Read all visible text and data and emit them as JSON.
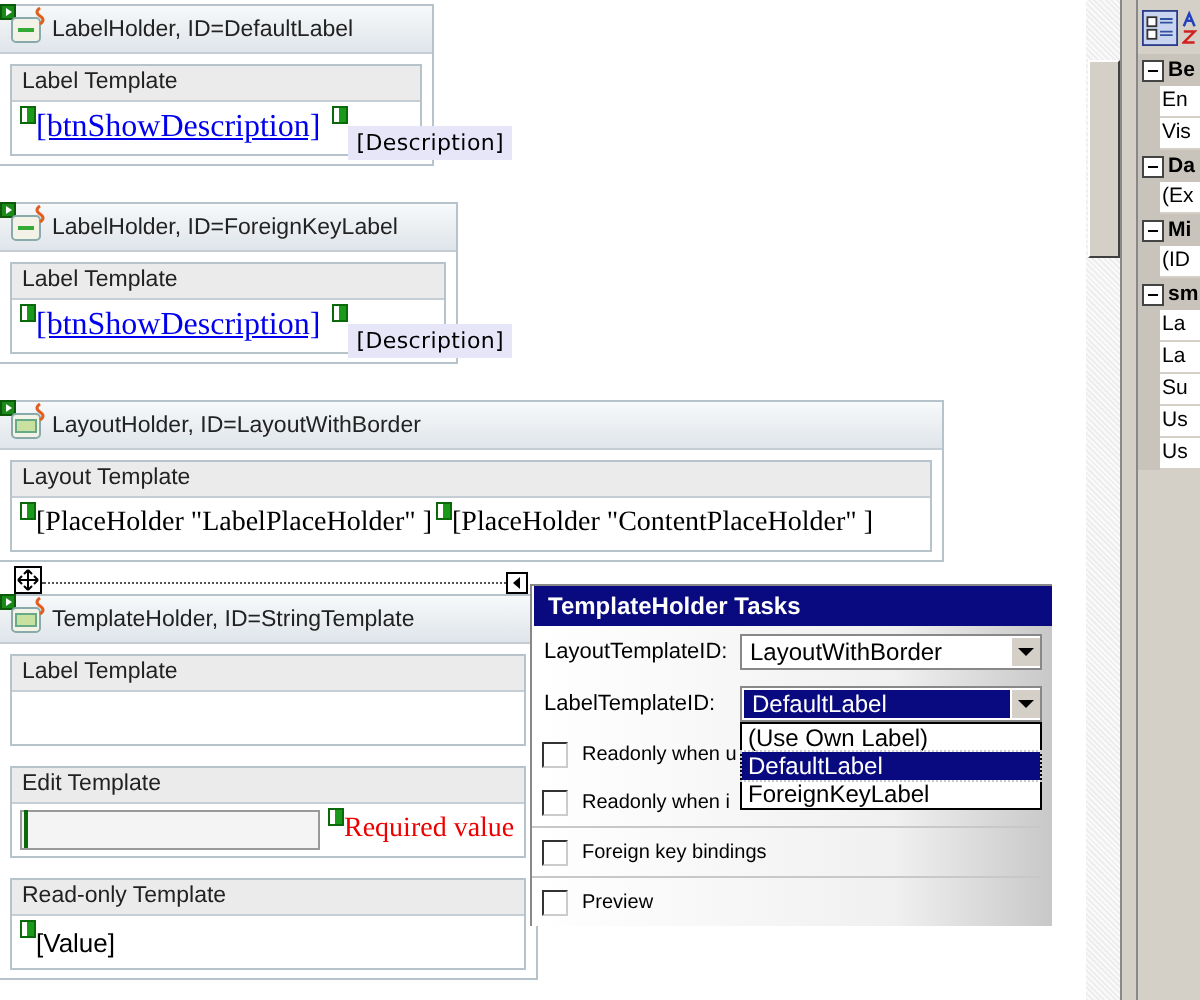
{
  "designer": {
    "controls": [
      {
        "kind": "label_holder",
        "title": "LabelHolder, ID=DefaultLabel",
        "template_heading": "Label Template",
        "link": "[btnShowDescription]",
        "tag": "[Description]"
      },
      {
        "kind": "label_holder",
        "title": "LabelHolder, ID=ForeignKeyLabel",
        "template_heading": "Label Template",
        "link": "[btnShowDescription]",
        "tag": "[Description]"
      },
      {
        "kind": "layout_holder",
        "title": "LayoutHolder, ID=LayoutWithBorder",
        "template_heading": "Layout Template",
        "placeholders": [
          "[PlaceHolder \"LabelPlaceHolder\" ]",
          "[PlaceHolder \"ContentPlaceHolder\" ]"
        ]
      },
      {
        "kind": "template_holder",
        "title": "TemplateHolder, ID=StringTemplate",
        "selected": true,
        "sections": [
          {
            "kind": "empty",
            "heading": "Label Template"
          },
          {
            "kind": "edit",
            "heading": "Edit Template",
            "validator": "Required value"
          },
          {
            "kind": "readonly",
            "heading": "Read-only Template",
            "value": "[Value]"
          }
        ]
      }
    ]
  },
  "tasks": {
    "title": "TemplateHolder Tasks",
    "fields": [
      {
        "label": "LayoutTemplateID:",
        "value": "LayoutWithBorder",
        "open": false
      },
      {
        "label": "LabelTemplateID:",
        "value": "DefaultLabel",
        "open": true,
        "options": [
          {
            "label": "(Use Own Label)",
            "selected": false
          },
          {
            "label": "DefaultLabel",
            "selected": true
          },
          {
            "label": "ForeignKeyLabel",
            "selected": false
          }
        ]
      }
    ],
    "checks": [
      {
        "label": "Readonly when u",
        "checked": false
      },
      {
        "label": "Readonly when i",
        "checked": false
      },
      {
        "label": "Foreign key bindings",
        "checked": false
      },
      {
        "label": "Preview",
        "checked": false
      }
    ]
  },
  "properties": {
    "categories": [
      {
        "name": "Be",
        "expanded": true,
        "items": [
          "En",
          "Vis"
        ]
      },
      {
        "name": "Da",
        "expanded": true,
        "items": [
          "(Ex"
        ]
      },
      {
        "name": "Mi",
        "expanded": true,
        "items": [
          "(ID"
        ]
      },
      {
        "name": "sm",
        "expanded": true,
        "items": [
          "La",
          "La",
          "Su",
          "Us",
          "Us"
        ]
      }
    ]
  }
}
